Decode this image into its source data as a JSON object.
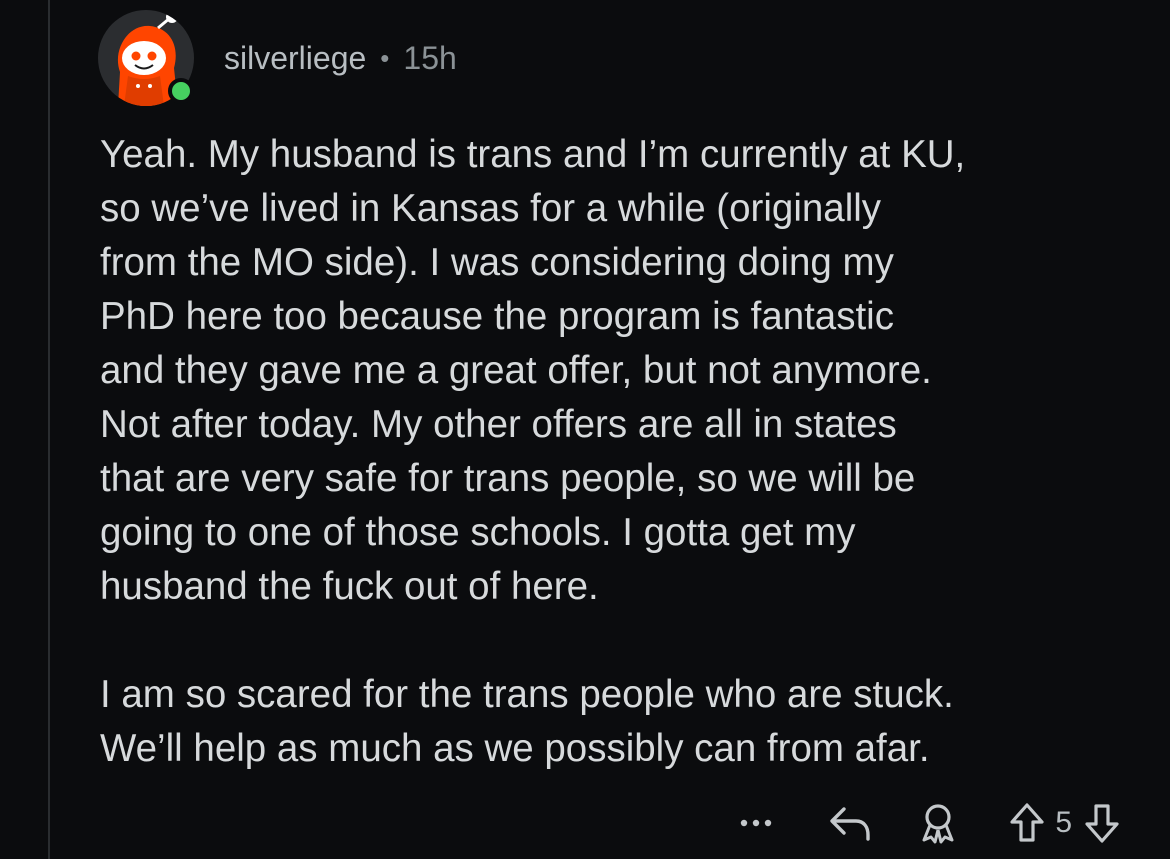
{
  "comment": {
    "author": "silverliege",
    "separator": "•",
    "age": "15h",
    "paragraphs": [
      "Yeah. My husband is trans and I’m currently at KU,\nso we’ve lived in Kansas for a while (originally\nfrom the MO side). I was considering doing my\nPhD here too because the program is fantastic\nand they gave me a great offer, but not anymore.\nNot after today. My other offers are all in states\nthat are very safe for trans people, so we will be\ngoing to one of those schools. I gotta get my\nhusband the fuck out of here.",
      "I am so scared for the trans people who are stuck.\nWe’ll help as much as we possibly can from afar."
    ],
    "vote_count": "5"
  },
  "icons": {
    "avatar": "snoo-avatar",
    "online": "online-status-dot",
    "more": "more-icon",
    "reply": "reply-icon",
    "award": "award-icon",
    "upvote": "upvote-icon",
    "downvote": "downvote-icon"
  },
  "colors": {
    "background": "#0b0c0e",
    "text": "#d7dadc",
    "muted": "#8b9296",
    "snoo_orange": "#ff4500",
    "online": "#46d160"
  }
}
